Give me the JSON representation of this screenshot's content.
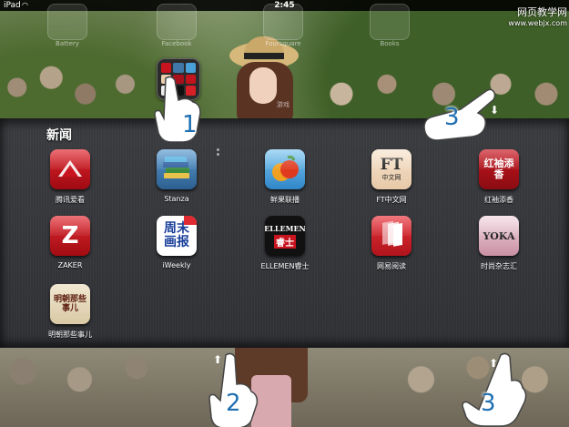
{
  "status_bar": {
    "carrier": "iPad",
    "wifi_icon": "wifi-icon",
    "time": "2:45"
  },
  "watermark": {
    "title": "网页教学网",
    "site": "www.webjx.com"
  },
  "top_row_ghost_apps": [
    "Battery",
    "Facebook",
    "Foursquare",
    "Books"
  ],
  "second_row_ghost_apps": [
    "",
    "",
    "游戏",
    ""
  ],
  "folder": {
    "title": "新闻",
    "apps": [
      {
        "name": "腾讯爱看",
        "icon": "book-red-icon",
        "color": "#c8141e"
      },
      {
        "name": "Stanza",
        "icon": "books-stack-icon",
        "color": "#3f78a8"
      },
      {
        "name": "鲜果联播",
        "icon": "fruit-icon",
        "color": "#4aa0d8"
      },
      {
        "name": "FT中文网",
        "icon": "ft-logo-icon",
        "color": "#f1d6b8",
        "text": "FT",
        "subtext": "中文网"
      },
      {
        "name": "红袖添香",
        "icon": "calligraphy-icon",
        "color": "#a8101c",
        "text": "红袖添香"
      },
      {
        "name": "ZAKER",
        "icon": "zaker-z-icon",
        "color": "#c3141b",
        "text": "Z"
      },
      {
        "name": "iWeekly",
        "icon": "iweekly-icon",
        "color": "#ffffff",
        "text": "周末画报"
      },
      {
        "name": "ELLEMEN睿士",
        "icon": "ellemen-icon",
        "color": "#111111",
        "text": "ELLEMEN",
        "subtext": "睿士"
      },
      {
        "name": "网易阅读",
        "icon": "netease-reader-icon",
        "color": "#d61f26"
      },
      {
        "name": "时尚杂志汇",
        "icon": "yoka-icon",
        "color": "#e8c9d2",
        "text": "YOKA"
      },
      {
        "name": "明朝那些事儿",
        "icon": "ming-book-icon",
        "color": "#e7dcc3",
        "text": "明朝那些事儿"
      }
    ]
  },
  "annotations": {
    "step1": "1",
    "step2": "2",
    "step3_top": "3",
    "step3_bottom": "3"
  }
}
